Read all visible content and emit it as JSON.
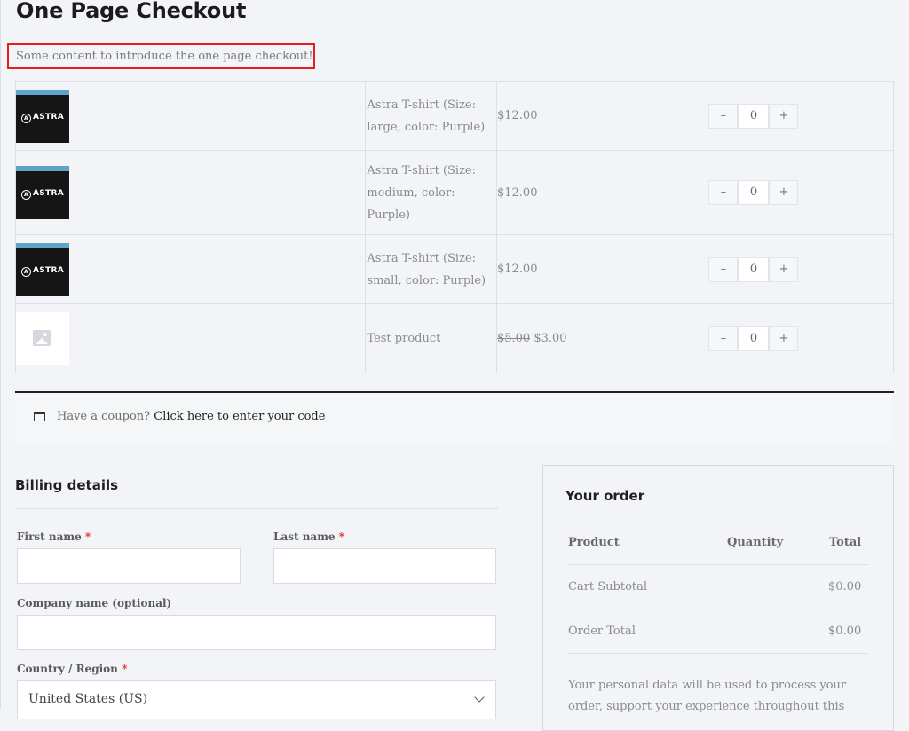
{
  "page": {
    "title": "One Page Checkout",
    "intro": "Some content to introduce the one page checkout!"
  },
  "products": [
    {
      "name": "Astra T-shirt  (Size: large, color: Purple)",
      "lines": [
        "Astra T-shirt  (Size:",
        "large, color: Purple)"
      ],
      "price": "$12.00",
      "old_price": "",
      "qty": "0",
      "image": "astra-tshirt"
    },
    {
      "name": "Astra T-shirt  (Size: medium, color: Purple)",
      "lines": [
        "Astra T-shirt  (Size:",
        "medium, color:",
        "Purple)"
      ],
      "price": "$12.00",
      "old_price": "",
      "qty": "0",
      "image": "astra-tshirt"
    },
    {
      "name": "Astra T-shirt  (Size: small, color: Purple)",
      "lines": [
        "Astra T-shirt  (Size:",
        "small, color: Purple)"
      ],
      "price": "$12.00",
      "old_price": "",
      "qty": "0",
      "image": "astra-tshirt"
    },
    {
      "name": "Test product",
      "lines": [
        "Test product"
      ],
      "price": "$3.00",
      "old_price": "$5.00",
      "qty": "0",
      "image": "placeholder-image"
    }
  ],
  "stepper": {
    "minus": "–",
    "plus": "+"
  },
  "thumb_logo": "ASTRA",
  "coupon": {
    "prompt": "Have a coupon?",
    "link": "Click here to enter your code",
    "icon": "coupon-icon"
  },
  "billing": {
    "title": "Billing details",
    "first_name": {
      "label": "First name",
      "required": "*",
      "value": ""
    },
    "last_name": {
      "label": "Last name",
      "required": "*",
      "value": ""
    },
    "company": {
      "label": "Company name (optional)",
      "value": ""
    },
    "country": {
      "label": "Country / Region",
      "required": "*",
      "value": "United States (US)"
    }
  },
  "order": {
    "title": "Your order",
    "headers": {
      "product": "Product",
      "quantity": "Quantity",
      "total": "Total"
    },
    "subtotal": {
      "label": "Cart Subtotal",
      "value": "$0.00"
    },
    "total": {
      "label": "Order Total",
      "value": "$0.00"
    },
    "privacy": "Your personal data will be used to process your order, support your experience throughout this"
  },
  "colors": {
    "highlight": "#e02020",
    "required": "#d9302b",
    "text_dark": "#1f1f1f"
  }
}
